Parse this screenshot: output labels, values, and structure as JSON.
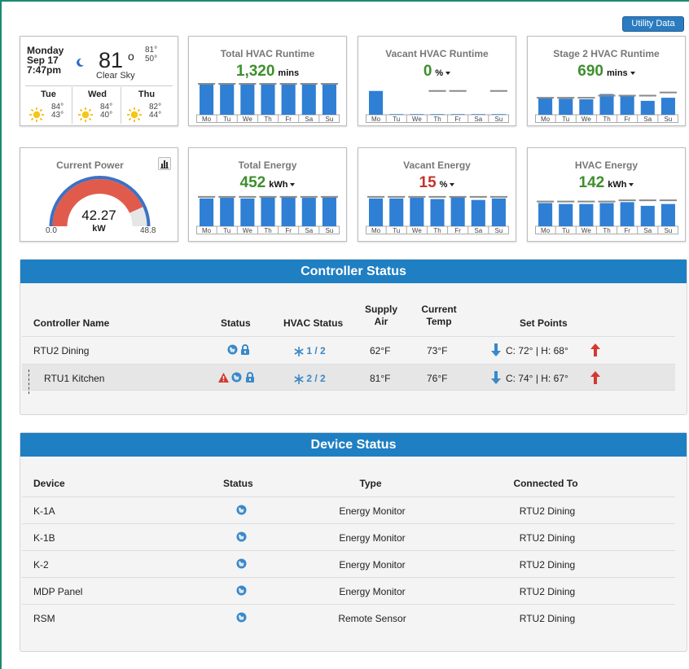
{
  "toolbar": {
    "utility_label": "Utility Data"
  },
  "weather": {
    "day": "Monday",
    "date": "Sep 17",
    "time": "7:47pm",
    "temp": "81",
    "deg": "o",
    "hi": "81°",
    "lo": "50°",
    "condition": "Clear Sky",
    "forecast": [
      {
        "day": "Tue",
        "hi": "84°",
        "lo": "43°"
      },
      {
        "day": "Wed",
        "hi": "84°",
        "lo": "40°"
      },
      {
        "day": "Thu",
        "hi": "82°",
        "lo": "44°"
      }
    ]
  },
  "days": [
    "Mo",
    "Tu",
    "We",
    "Th",
    "Fr",
    "Sa",
    "Su"
  ],
  "cards": {
    "hvac_runtime": {
      "title": "Total HVAC Runtime",
      "value": "1,320",
      "unit": "mins"
    },
    "vacant_runtime": {
      "title": "Vacant HVAC Runtime",
      "value": "0",
      "unit": "%"
    },
    "stage2_runtime": {
      "title": "Stage 2 HVAC Runtime",
      "value": "690",
      "unit": "mins"
    },
    "total_energy": {
      "title": "Total Energy",
      "value": "452",
      "unit": "kWh"
    },
    "vacant_energy": {
      "title": "Vacant Energy",
      "value": "15",
      "unit": "%"
    },
    "hvac_energy": {
      "title": "HVAC Energy",
      "value": "142",
      "unit": "kWh"
    }
  },
  "power": {
    "title": "Current Power",
    "value": "42.27",
    "unit": "kW",
    "min": "0.0",
    "max": "48.8",
    "fraction": 0.866
  },
  "colors": {
    "header": "#1f7fc3",
    "bar": "#2f7fd4",
    "gauge_fill": "#e15b4d",
    "gauge_track": "#3c72c4",
    "good": "#3e8f2e",
    "bad": "#c4332c",
    "icon": "#3a88c9"
  },
  "controller_status": {
    "title": "Controller Status",
    "headers": {
      "name": "Controller Name",
      "status": "Status",
      "hvac": "HVAC Status",
      "supply_1": "Supply",
      "supply_2": "Air",
      "current_1": "Current",
      "current_2": "Temp",
      "setpoints": "Set Points"
    },
    "rows": [
      {
        "name": "RTU2 Dining",
        "hvac": "1 / 2",
        "supply": "62°F",
        "current": "73°F",
        "setpoints": "C:  72° | H:  68°"
      },
      {
        "name": "RTU1 Kitchen",
        "hvac": "2 / 2",
        "supply": "81°F",
        "current": "76°F",
        "setpoints": "C:  74° | H:  67°"
      }
    ]
  },
  "device_status": {
    "title": "Device Status",
    "headers": {
      "device": "Device",
      "status": "Status",
      "type": "Type",
      "connected": "Connected To"
    },
    "rows": [
      {
        "device": "K-1A",
        "type": "Energy Monitor",
        "connected": "RTU2 Dining"
      },
      {
        "device": "K-1B",
        "type": "Energy Monitor",
        "connected": "RTU2 Dining"
      },
      {
        "device": "K-2",
        "type": "Energy Monitor",
        "connected": "RTU2 Dining"
      },
      {
        "device": "MDP Panel",
        "type": "Energy Monitor",
        "connected": "RTU2 Dining"
      },
      {
        "device": "RSM",
        "type": "Remote Sensor",
        "connected": "RTU2 Dining"
      }
    ]
  },
  "chart_data": [
    {
      "type": "bar",
      "title": "Total HVAC Runtime",
      "categories": [
        "Mo",
        "Tu",
        "We",
        "Th",
        "Fr",
        "Sa",
        "Su"
      ],
      "series": [
        {
          "values": [
            1,
            1,
            1,
            1,
            1,
            1,
            1
          ]
        },
        {
          "values": [
            1,
            1,
            1,
            1,
            1,
            1,
            1
          ]
        }
      ],
      "ylim": [
        0,
        1
      ]
    },
    {
      "type": "bar",
      "title": "Vacant HVAC Runtime",
      "categories": [
        "Mo",
        "Tu",
        "We",
        "Th",
        "Fr",
        "Sa",
        "Su"
      ],
      "series": [
        {
          "values": [
            0.77,
            0.02,
            0.02,
            0.02,
            0.02,
            0.02,
            0.02
          ]
        },
        {
          "values": [
            0,
            0,
            0,
            0.77,
            0.77,
            0,
            0.77
          ]
        }
      ],
      "ylim": [
        0,
        1
      ]
    },
    {
      "type": "bar",
      "title": "Stage 2 HVAC Runtime",
      "categories": [
        "Mo",
        "Tu",
        "We",
        "Th",
        "Fr",
        "Sa",
        "Su"
      ],
      "series": [
        {
          "values": [
            0.55,
            0.52,
            0.5,
            0.67,
            0.6,
            0.45,
            0.55
          ]
        },
        {
          "values": [
            0.55,
            0.55,
            0.55,
            0.62,
            0.62,
            0.62,
            0.72
          ]
        }
      ],
      "ylim": [
        0,
        1
      ]
    },
    {
      "type": "bar",
      "title": "Total Energy",
      "categories": [
        "Mo",
        "Tu",
        "We",
        "Th",
        "Fr",
        "Sa",
        "Su"
      ],
      "series": [
        {
          "values": [
            0.9,
            0.92,
            0.9,
            0.93,
            0.95,
            0.92,
            0.93
          ]
        },
        {
          "values": [
            0.95,
            0.95,
            0.95,
            0.95,
            0.95,
            0.95,
            0.95
          ]
        }
      ],
      "ylim": [
        0,
        1
      ]
    },
    {
      "type": "bar",
      "title": "Vacant Energy",
      "categories": [
        "Mo",
        "Tu",
        "We",
        "Th",
        "Fr",
        "Sa",
        "Su"
      ],
      "series": [
        {
          "values": [
            0.9,
            0.9,
            0.92,
            0.88,
            0.95,
            0.85,
            0.9
          ]
        },
        {
          "values": [
            0.95,
            0.95,
            0.95,
            0.95,
            0.95,
            0.95,
            0.95
          ]
        }
      ],
      "ylim": [
        0,
        1
      ]
    },
    {
      "type": "bar",
      "title": "HVAC Energy",
      "categories": [
        "Mo",
        "Tu",
        "We",
        "Th",
        "Fr",
        "Sa",
        "Su"
      ],
      "series": [
        {
          "values": [
            0.75,
            0.72,
            0.72,
            0.75,
            0.78,
            0.66,
            0.72
          ]
        },
        {
          "values": [
            0.8,
            0.8,
            0.8,
            0.8,
            0.84,
            0.84,
            0.84
          ]
        }
      ],
      "ylim": [
        0,
        1
      ]
    }
  ]
}
